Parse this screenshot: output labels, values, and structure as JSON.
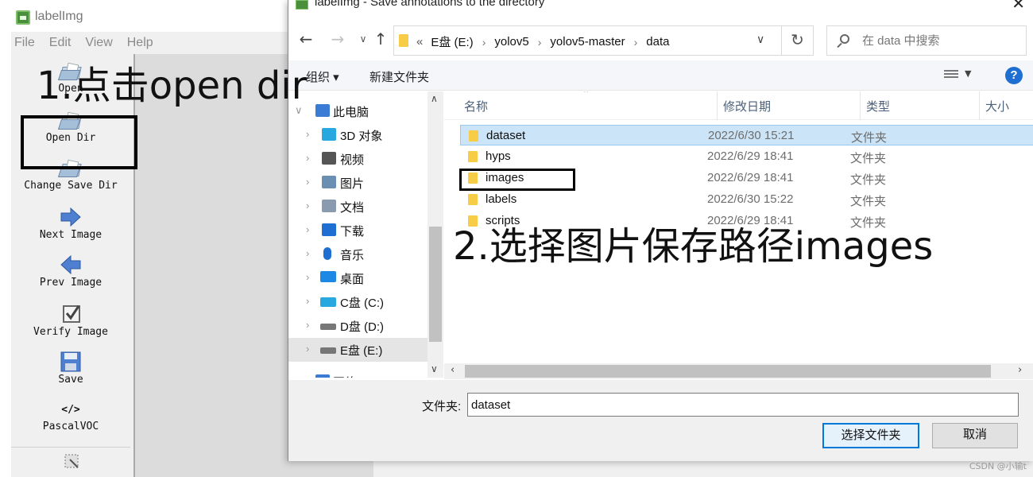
{
  "app": {
    "title": "labelImg",
    "menu": [
      "File",
      "Edit",
      "View",
      "Help"
    ],
    "toolbar": [
      {
        "label": "Open",
        "icon": "folder-icon"
      },
      {
        "label": "Open Dir",
        "icon": "folder-icon"
      },
      {
        "label": "Change Save Dir",
        "icon": "folder-icon"
      },
      {
        "label": "Next Image",
        "icon": "arrow-right-icon"
      },
      {
        "label": "Prev Image",
        "icon": "arrow-left-icon"
      },
      {
        "label": "Verify Image",
        "icon": "checkbox-icon"
      },
      {
        "label": "Save",
        "icon": "floppy-icon"
      },
      {
        "label": "PascalVOC",
        "icon": "code-icon",
        "icon_text": "</>"
      }
    ]
  },
  "dialog": {
    "title": "labelImg - Save annotations to the directory",
    "address": {
      "prefix": "«",
      "crumbs": [
        "E盘 (E:)",
        "yolov5",
        "yolov5-master",
        "data"
      ]
    },
    "search_placeholder": "在 data 中搜索",
    "commands": {
      "organize": "组织 ▾",
      "new_folder": "新建文件夹",
      "help": "?"
    },
    "nav_tree": [
      {
        "label": "此电脑",
        "icon": "computer-icon",
        "color": "#3a7bd5"
      },
      {
        "label": "3D 对象",
        "icon": "cube-icon",
        "color": "#29a8e0"
      },
      {
        "label": "视频",
        "icon": "film-icon",
        "color": "#555555"
      },
      {
        "label": "图片",
        "icon": "picture-icon",
        "color": "#6b8fb3"
      },
      {
        "label": "文档",
        "icon": "document-icon",
        "color": "#8a9bb0"
      },
      {
        "label": "下载",
        "icon": "download-icon",
        "color": "#1e6fd1"
      },
      {
        "label": "音乐",
        "icon": "music-icon",
        "color": "#1e6fd1"
      },
      {
        "label": "桌面",
        "icon": "desktop-icon",
        "color": "#1e88e5"
      },
      {
        "label": "C盘 (C:)",
        "icon": "windows-drive-icon",
        "color": "#29a8e0"
      },
      {
        "label": "D盘 (D:)",
        "icon": "drive-icon",
        "color": "#777777"
      },
      {
        "label": "E盘 (E:)",
        "icon": "drive-icon",
        "color": "#777777"
      },
      {
        "label": "网络",
        "icon": "network-icon",
        "color": "#3a7bd5"
      }
    ],
    "columns": [
      "名称",
      "修改日期",
      "类型",
      "大小"
    ],
    "files": [
      {
        "name": "dataset",
        "date": "2022/6/30 15:21",
        "type": "文件夹",
        "selected": true
      },
      {
        "name": "hyps",
        "date": "2022/6/29 18:41",
        "type": "文件夹",
        "selected": false
      },
      {
        "name": "images",
        "date": "2022/6/29 18:41",
        "type": "文件夹",
        "selected": false
      },
      {
        "name": "labels",
        "date": "2022/6/30 15:22",
        "type": "文件夹",
        "selected": false
      },
      {
        "name": "scripts",
        "date": "2022/6/29 18:41",
        "type": "文件夹",
        "selected": false
      }
    ],
    "folder_label": "文件夹:",
    "folder_value": "dataset",
    "select_button": "选择文件夹",
    "cancel_button": "取消"
  },
  "annotations": {
    "step1": "1.点击open dir",
    "step2": "2.选择图片保存路径images"
  },
  "watermark": "CSDN @小输t",
  "colors": {
    "accent": "#0078d7",
    "selection": "#cce4f7",
    "folder": "#f7cd48",
    "help": "#1e6fd1"
  }
}
